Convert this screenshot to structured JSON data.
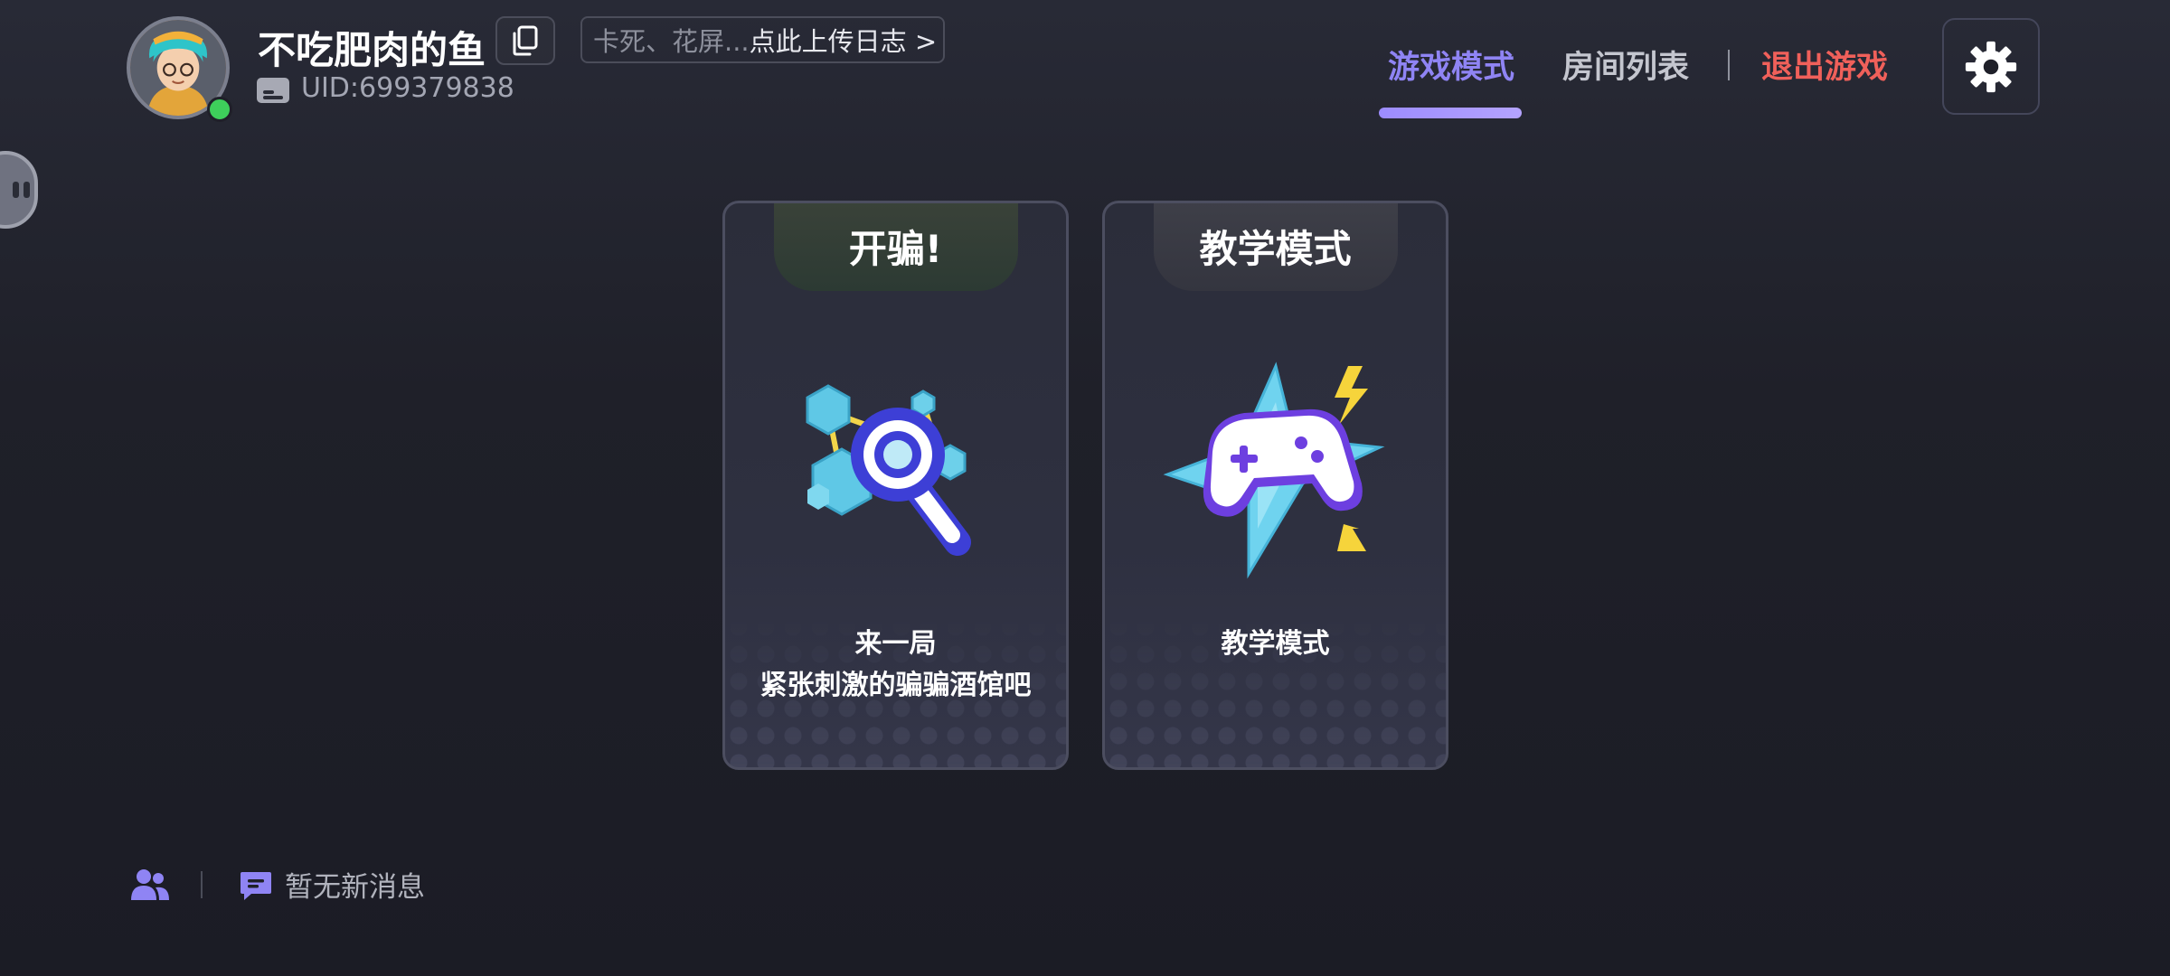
{
  "user": {
    "name": "不吃肥肉的鱼",
    "uid": "UID:699379838",
    "status": "online"
  },
  "log_upload": {
    "hint": "卡死、花屏...",
    "link": "点此上传日志 >"
  },
  "nav": {
    "tabs": [
      {
        "label": "游戏模式",
        "active": true
      },
      {
        "label": "房间列表",
        "active": false
      }
    ],
    "exit_label": "退出游戏"
  },
  "cards": [
    {
      "tab": "开骗!",
      "icon": "molecule-magnifier-icon",
      "desc_line1": "来一局",
      "desc_line2": "紧张刺激的骗骗酒馆吧"
    },
    {
      "tab": "教学模式",
      "icon": "gamepad-icon",
      "desc_line1": "教学模式"
    }
  ],
  "footer": {
    "message": "暂无新消息"
  },
  "colors": {
    "accent": "#8f84f4",
    "exit": "#f0605a",
    "online": "#3ecf5b",
    "background": "#1f2029"
  }
}
